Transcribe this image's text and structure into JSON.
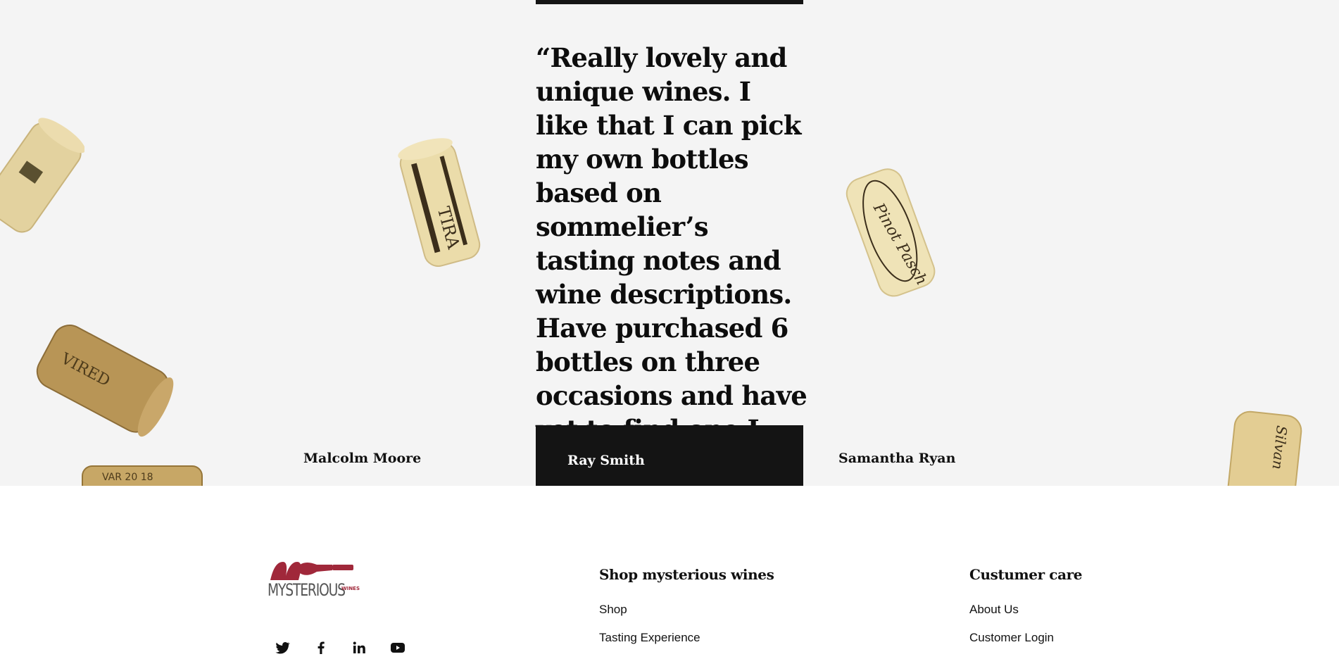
{
  "testimonials": {
    "quote": "“Really lovely and unique wines. I like that I can pick my own bottles based on sommelier’s tasting notes and wine descriptions. Have purchased 6 bottles on three occasions and have yet to find one I didn’t like.”",
    "authors": [
      "Malcolm Moore",
      "Ray Smith",
      "Samantha Ryan"
    ],
    "active_author_index": 1
  },
  "footer": {
    "logo": {
      "name": "MYSTERIOUS",
      "sub": "WINES",
      "brand_color": "#a0283a"
    },
    "social": [
      "twitter-icon",
      "facebook-icon",
      "linkedin-icon",
      "youtube-icon"
    ],
    "shop": {
      "title": "Shop mysterious wines",
      "links": [
        "Shop",
        "Tasting Experience"
      ]
    },
    "care": {
      "title": "Custumer care",
      "links": [
        "About Us",
        "Customer Login"
      ]
    }
  }
}
